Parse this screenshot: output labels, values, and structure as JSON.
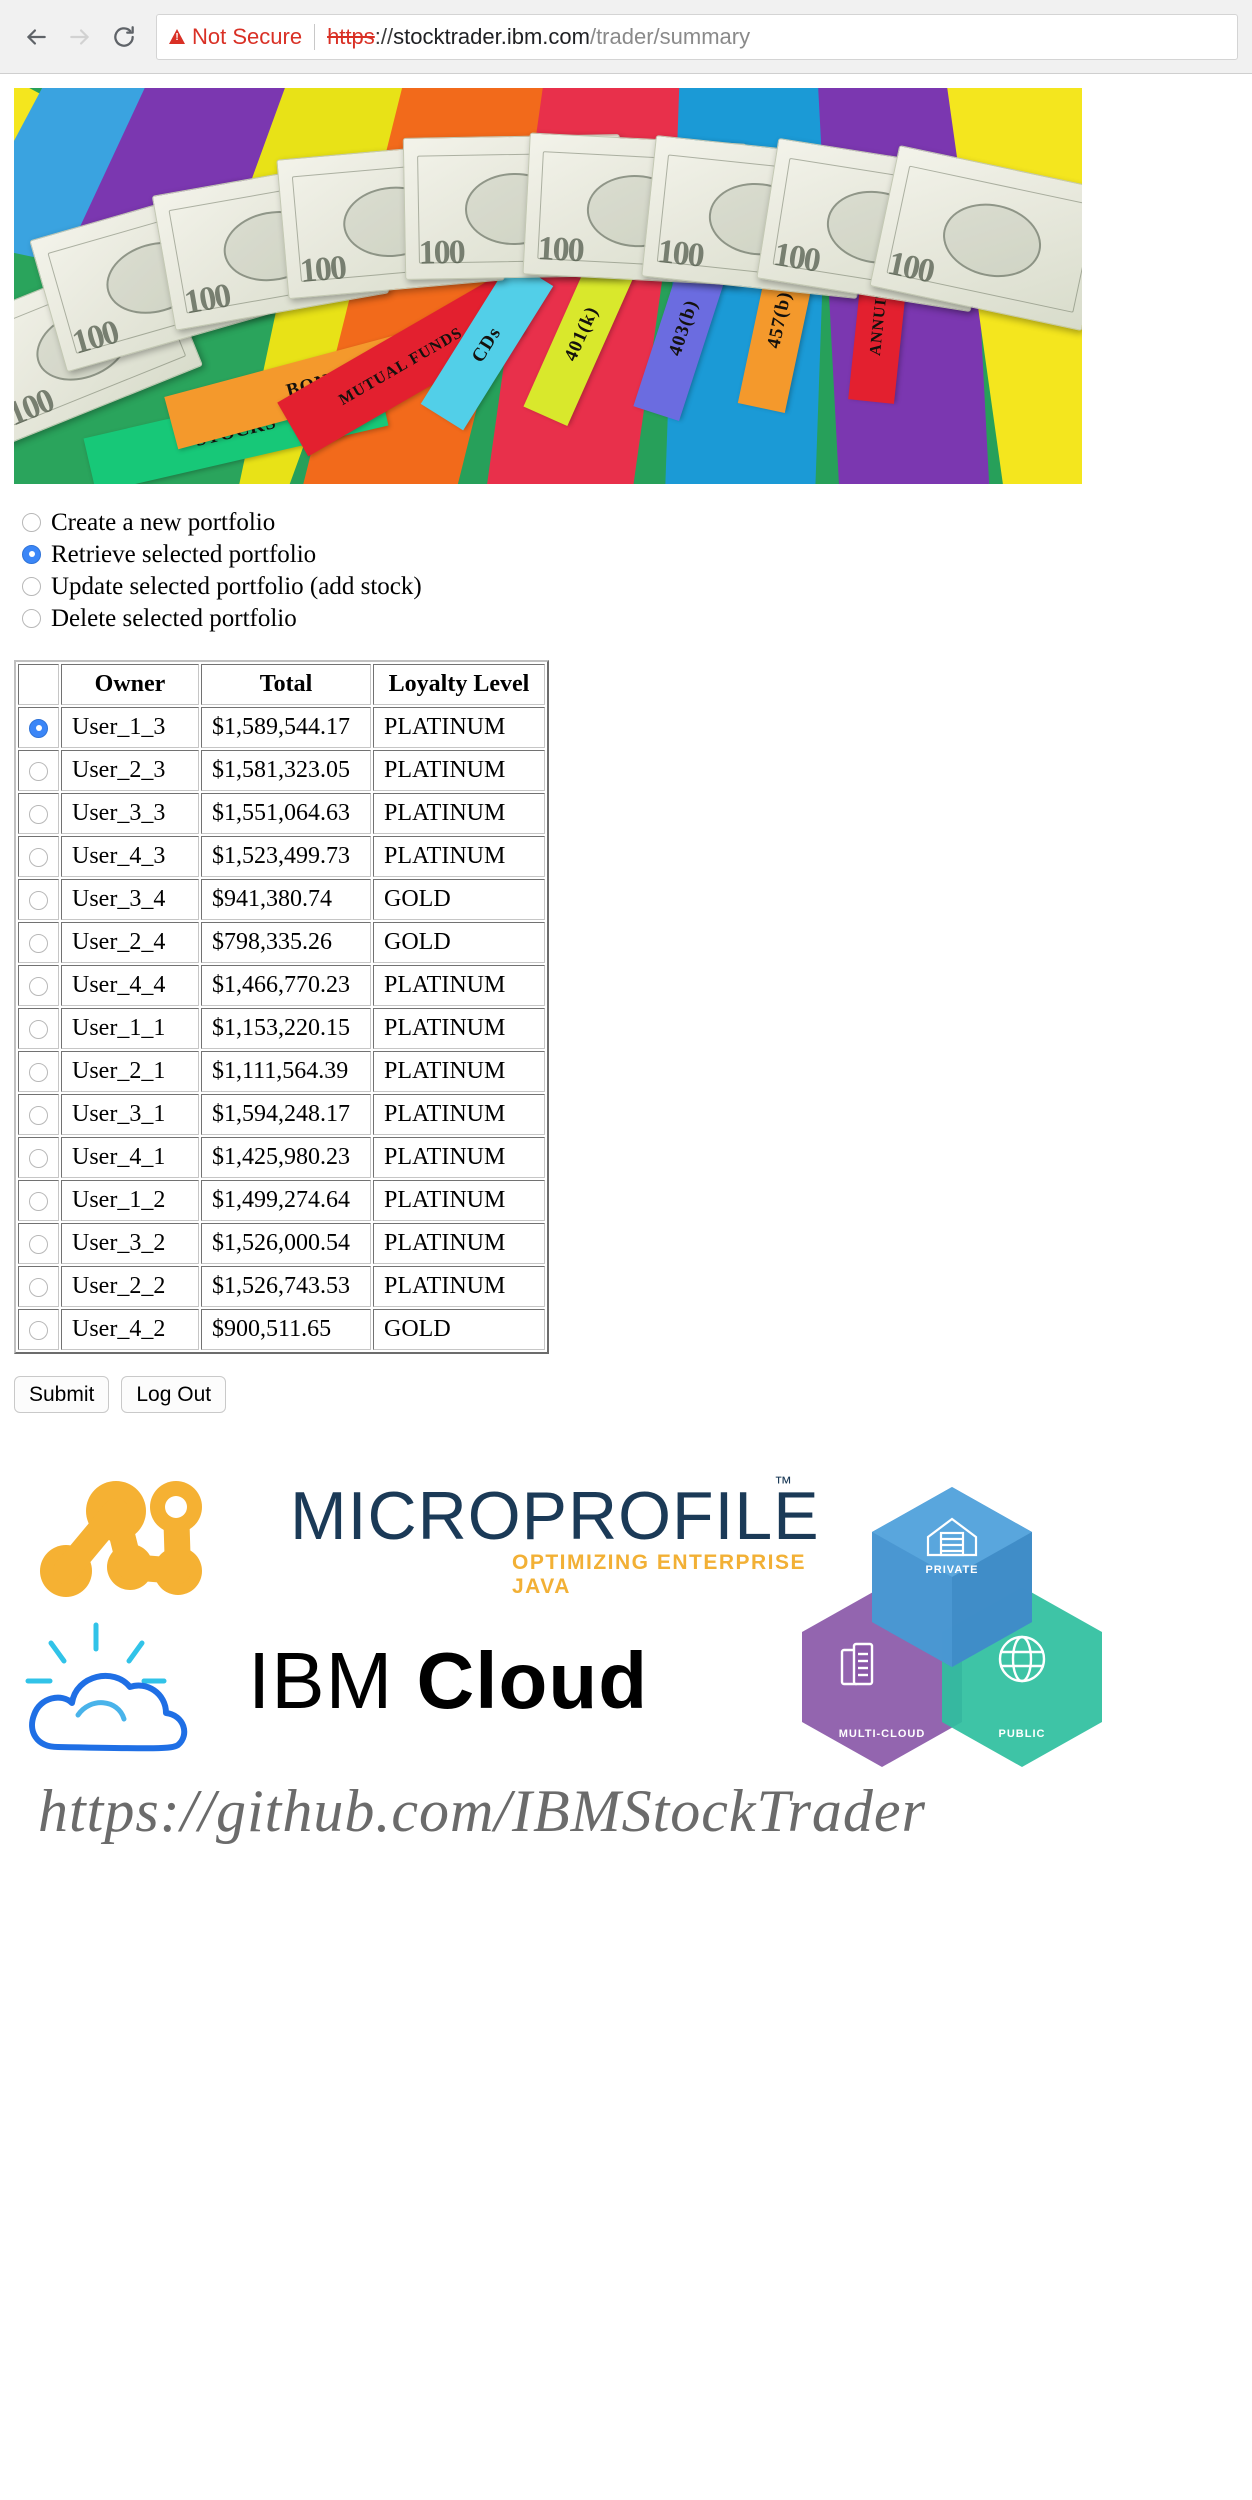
{
  "browser": {
    "back_icon": "back-arrow-icon",
    "forward_icon": "forward-arrow-icon",
    "reload_icon": "reload-icon",
    "warning_icon": "warning-triangle-icon",
    "security_label": "Not Secure",
    "url_scheme": "https",
    "url_sep": "://",
    "url_host": "stocktrader.ibm.com",
    "url_path": "/trader/summary",
    "full_url": "https://stocktrader.ibm.com/trader/summary"
  },
  "banner": {
    "alt": "Hundred dollar bills fanned over colored investment category file tabs",
    "tabs": [
      "STOCKS",
      "BONDS",
      "MUTUAL FUNDS",
      "CDs",
      "401(k)",
      "403(b)",
      "457(b)",
      "ANNUITIES"
    ]
  },
  "operations": {
    "selected_index": 1,
    "items": [
      {
        "label": "Create a new portfolio",
        "selected": false
      },
      {
        "label": "Retrieve selected portfolio",
        "selected": true
      },
      {
        "label": "Update selected portfolio (add stock)",
        "selected": false
      },
      {
        "label": "Delete selected portfolio",
        "selected": false
      }
    ]
  },
  "table": {
    "columns": [
      "",
      "Owner",
      "Total",
      "Loyalty Level"
    ],
    "selected_row": 0,
    "rows": [
      {
        "selected": true,
        "owner": "User_1_3",
        "total": "$1,589,544.17",
        "loyalty": "PLATINUM"
      },
      {
        "selected": false,
        "owner": "User_2_3",
        "total": "$1,581,323.05",
        "loyalty": "PLATINUM"
      },
      {
        "selected": false,
        "owner": "User_3_3",
        "total": "$1,551,064.63",
        "loyalty": "PLATINUM"
      },
      {
        "selected": false,
        "owner": "User_4_3",
        "total": "$1,523,499.73",
        "loyalty": "PLATINUM"
      },
      {
        "selected": false,
        "owner": "User_3_4",
        "total": "$941,380.74",
        "loyalty": "GOLD"
      },
      {
        "selected": false,
        "owner": "User_2_4",
        "total": "$798,335.26",
        "loyalty": "GOLD"
      },
      {
        "selected": false,
        "owner": "User_4_4",
        "total": "$1,466,770.23",
        "loyalty": "PLATINUM"
      },
      {
        "selected": false,
        "owner": "User_1_1",
        "total": "$1,153,220.15",
        "loyalty": "PLATINUM"
      },
      {
        "selected": false,
        "owner": "User_2_1",
        "total": "$1,111,564.39",
        "loyalty": "PLATINUM"
      },
      {
        "selected": false,
        "owner": "User_3_1",
        "total": "$1,594,248.17",
        "loyalty": "PLATINUM"
      },
      {
        "selected": false,
        "owner": "User_4_1",
        "total": "$1,425,980.23",
        "loyalty": "PLATINUM"
      },
      {
        "selected": false,
        "owner": "User_1_2",
        "total": "$1,499,274.64",
        "loyalty": "PLATINUM"
      },
      {
        "selected": false,
        "owner": "User_3_2",
        "total": "$1,526,000.54",
        "loyalty": "PLATINUM"
      },
      {
        "selected": false,
        "owner": "User_2_2",
        "total": "$1,526,743.53",
        "loyalty": "PLATINUM"
      },
      {
        "selected": false,
        "owner": "User_4_2",
        "total": "$900,511.65",
        "loyalty": "GOLD"
      }
    ]
  },
  "actions": {
    "submit_label": "Submit",
    "logout_label": "Log Out"
  },
  "footer": {
    "microprofile_name": "MICROPROFILE",
    "microprofile_tm": "™",
    "microprofile_tagline": "OPTIMIZING ENTERPRISE JAVA",
    "ibm_cloud_light": "IBM ",
    "ibm_cloud_bold": "Cloud",
    "github_url": "https://github.com/IBMStockTrader",
    "hexagons": [
      {
        "label": "PRIVATE",
        "color": "#4a97d2"
      },
      {
        "label": "MULTI-CLOUD",
        "color": "#8a58a8"
      },
      {
        "label": "PUBLIC",
        "color": "#2ebf9e"
      }
    ]
  },
  "colors": {
    "warning_red": "#d93025",
    "radio_blue": "#3b86f7",
    "microprofile_orange": "#f2b035",
    "microprofile_navy": "#1b3a57",
    "cloud_blue": "#1f6fe5"
  }
}
